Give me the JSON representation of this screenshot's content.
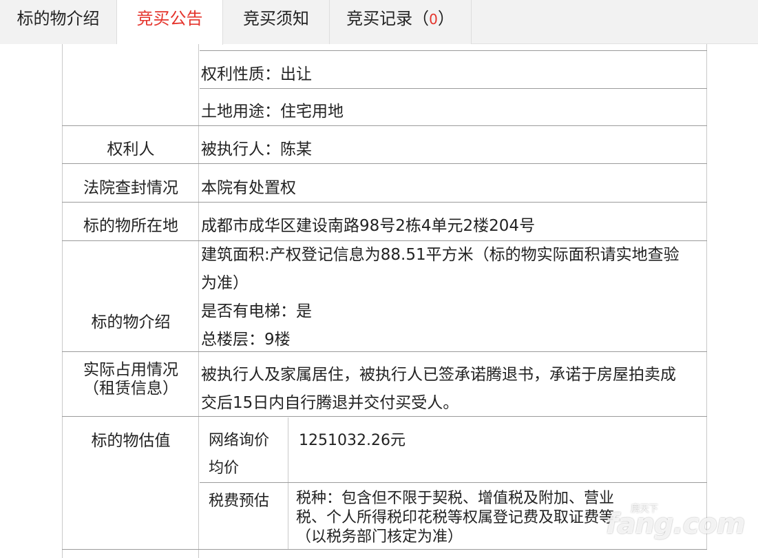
{
  "tabs": [
    {
      "label": "标的物介绍"
    },
    {
      "label": "竞买公告"
    },
    {
      "label": "竞买须知"
    },
    {
      "label": "竞买记录（",
      "count": "0",
      "suffix": "）"
    }
  ],
  "rows": {
    "right_nature": "权利性质：出让",
    "land_use": "土地用途：住宅用地",
    "right_holder": {
      "label": "权利人",
      "value": "被执行人：陈某"
    },
    "court_seal": {
      "label": "法院查封情况",
      "value": "本院有处置权"
    },
    "location": {
      "label": "标的物所在地",
      "value": "成都市成华区建设南路98号2栋4单元2楼204号"
    },
    "intro": {
      "label": "标的物介绍",
      "line1": "建筑面积:产权登记信息为88.51平方米（标的物实际面积请实地查验",
      "line2": "为准）",
      "line3": "是否有电梯：是",
      "line4": "总楼层：9楼"
    },
    "occupancy": {
      "label1": "实际占用情况",
      "label2": "（租赁信息）",
      "line1": "被执行人及家属居住，被执行人已签承诺腾退书，承诺于房屋拍卖成",
      "line2": "交后15日内自行腾退并交付买受人。"
    },
    "valuation": {
      "label": "标的物估值",
      "avg_label1": "网络询价",
      "avg_label2": "均价",
      "avg_value": "1251032.26元",
      "tax_label": "税费预估",
      "tax_line1": "税种：包含但不限于契税、增值税及附加、营业",
      "tax_line2": "税、个人所得税印花税等权属登记费及取证费等",
      "tax_line3": "（以税务部门核定为准）"
    }
  },
  "watermark": {
    "text": "fang.com",
    "small": "房天下"
  },
  "colors": {
    "accent": "#e4332b",
    "tab_bg": "#f2f2f2",
    "border": "#c9c9c9"
  }
}
